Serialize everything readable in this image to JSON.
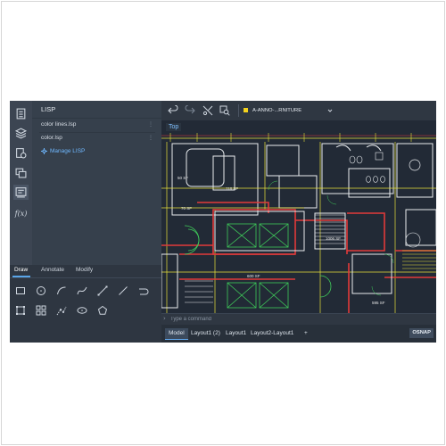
{
  "colors": {
    "accent_blue": "#5aa5e8",
    "link_blue": "#6fb8ff",
    "layer_yellow": "#f4d21d",
    "wall_red": "#e23a3a",
    "line_yellow": "#e8e23a",
    "stair_green": "#3fcc5a",
    "wall_white": "#e9ecef"
  },
  "rail": {
    "icons": [
      "properties-icon",
      "layers-icon",
      "blocks-icon",
      "xref-icon",
      "lisp-icon",
      "function-icon"
    ],
    "function_label": "f(x)"
  },
  "lisp_panel": {
    "title": "LISP",
    "files": [
      {
        "name": "color lines.lsp"
      },
      {
        "name": "color.lsp"
      }
    ],
    "more_icon": "ellipsis-icon",
    "manage_label": "Manage LISP"
  },
  "draw_panel": {
    "tabs": [
      "Draw",
      "Annotate",
      "Modify"
    ],
    "active_tab": "Draw",
    "tools_row1": [
      "rectangle-icon",
      "circle-icon",
      "arc-icon",
      "spline-icon",
      "line-icon",
      "polyline-icon",
      "undo-arc-icon"
    ],
    "tools_row2": [
      "hatch-icon",
      "array-icon",
      "points-icon",
      "ellipse-icon",
      "polygon-icon"
    ]
  },
  "toolbar": {
    "buttons": [
      "undo-icon",
      "redo-icon",
      "trim-icon",
      "zoom-icon"
    ],
    "layer_name": "A-ANNO-...RNITURE"
  },
  "canvas": {
    "view_label": "Top",
    "labels": [
      "50 SF",
      "118 SF",
      "70 SF",
      "1006 SF",
      "600 SF",
      "595 SF"
    ]
  },
  "command": {
    "prompt_symbol": "›",
    "placeholder": "Type a command"
  },
  "layouts": {
    "tabs": [
      "Model",
      "Layout1 (2)",
      "Layout1",
      "Layout2-Layout1"
    ],
    "active": "Model",
    "add_label": "+",
    "osnap_label": "OSNAP"
  }
}
